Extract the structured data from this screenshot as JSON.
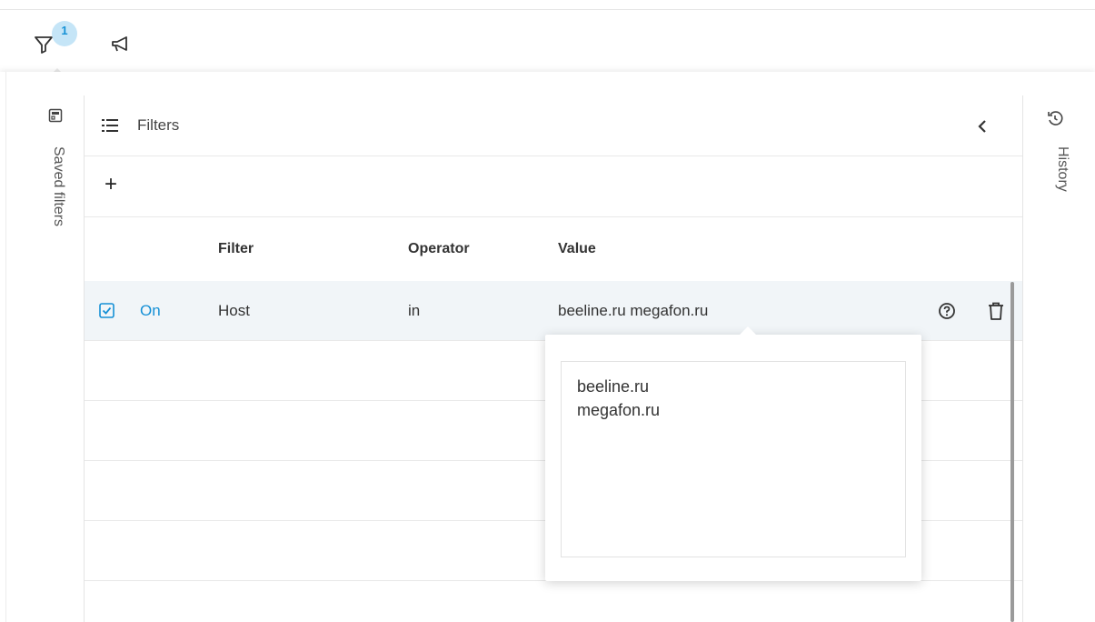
{
  "toolbar": {
    "filter_badge": "1",
    "icons": [
      "filter-icon",
      "megaphone-icon"
    ]
  },
  "saved_filters": {
    "label": "Saved filters",
    "icon": "saved-filters-icon"
  },
  "history": {
    "label": "History",
    "icon": "history-icon"
  },
  "filters_panel": {
    "title": "Filters",
    "add_label": "+",
    "columns": {
      "filter": "Filter",
      "operator": "Operator",
      "value": "Value"
    },
    "rows": [
      {
        "enabled": true,
        "state_label": "On",
        "filter": "Host",
        "operator": "in",
        "value": "beeline.ru megafon.ru"
      }
    ]
  },
  "value_popover": {
    "lines": "beeline.ru\nmegafon.ru"
  },
  "colors": {
    "accent": "#1590d6",
    "badge_bg": "#c5e5f7",
    "row_active": "#f1f5f8"
  }
}
